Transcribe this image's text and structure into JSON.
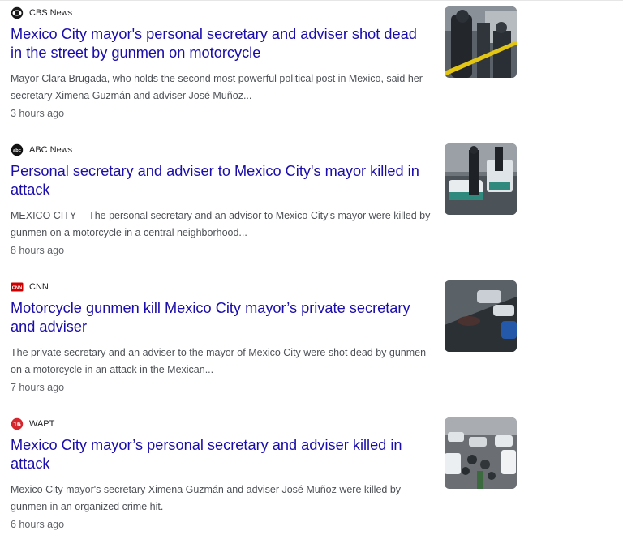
{
  "articles": [
    {
      "source": "CBS News",
      "logo_icon": "cbs-eye-icon",
      "title": "Mexico City mayor's personal secretary and adviser shot dead in the street by gunmen on motorcycle",
      "snippet": "Mayor Clara Brugada, who holds the second most powerful political post in Mexico, said her secretary Ximena Guzmán and adviser José Muñoz...",
      "time": "3 hours ago"
    },
    {
      "source": "ABC News",
      "logo_icon": "abc-news-logo-icon",
      "title": "Personal secretary and adviser to Mexico City's mayor killed in attack",
      "snippet": "MEXICO CITY -- The personal secretary and an advisor to Mexico City's mayor were killed by gunmen on a motorcycle in a central neighborhood...",
      "time": "8 hours ago"
    },
    {
      "source": "CNN",
      "logo_icon": "cnn-logo-icon",
      "title": "Motorcycle gunmen kill Mexico City mayor’s private secretary and adviser",
      "snippet": "The private secretary and an adviser to the mayor of Mexico City were shot dead by gunmen on a motorcycle in an attack in the Mexican...",
      "time": "7 hours ago"
    },
    {
      "source": "WAPT",
      "logo_icon": "wapt-16-logo-icon",
      "title": "Mexico City mayor’s personal secretary and adviser killed in attack",
      "snippet": "Mexico City mayor's secretary Ximena Guzmán and adviser José Muñoz were killed by gunmen in an organized crime hit.",
      "time": "6 hours ago"
    }
  ],
  "colors": {
    "title_link": "#1a0dab",
    "snippet_text": "#4d5156",
    "time_text": "#5f6368",
    "cnn_red": "#cc0000",
    "wapt_red": "#d6262d"
  }
}
